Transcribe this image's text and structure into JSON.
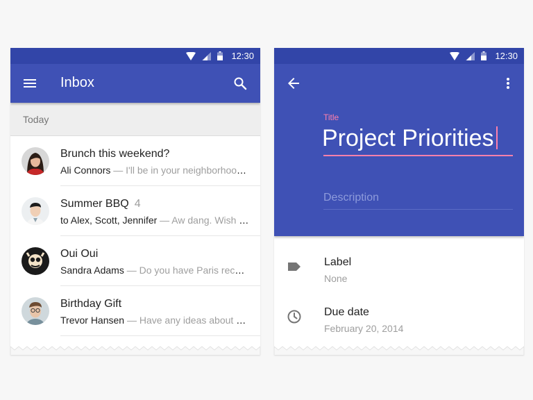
{
  "colors": {
    "primary": "#3f51b5",
    "status_bar": "#3245a8",
    "accent": "#ff80ab",
    "background": "#f7f7f7"
  },
  "status_bar": {
    "time": "12:30",
    "icons": [
      "wifi-icon",
      "signal-icon",
      "battery-icon"
    ]
  },
  "inbox": {
    "title": "Inbox",
    "nav_icon": "menu-icon",
    "action_icon": "search-icon",
    "section": "Today",
    "messages": [
      {
        "subject": "Brunch this weekend?",
        "count": "",
        "from": "Ali Connors",
        "preview": " — I'll be in your neighborhood doing errands this weekend",
        "avatar": "avatar-ali"
      },
      {
        "subject": "Summer BBQ",
        "count": "4",
        "from": "to Alex, Scott, Jennifer",
        "preview": " — Aw dang. Wish I could make it",
        "avatar": "avatar-summer"
      },
      {
        "subject": "Oui Oui",
        "count": "",
        "from": "Sandra Adams",
        "preview": " — Do you have Paris recommendations",
        "avatar": "avatar-sandra"
      },
      {
        "subject": "Birthday Gift",
        "count": "",
        "from": "Trevor Hansen",
        "preview": " — Have any ideas about what we should get",
        "avatar": "avatar-trevor"
      }
    ]
  },
  "task": {
    "back_icon": "arrow-back-icon",
    "more_icon": "more-vert-icon",
    "title_label": "Title",
    "title_value": "Project Priorities",
    "description_placeholder": "Description",
    "details": [
      {
        "icon": "label-icon",
        "title": "Label",
        "value": "None"
      },
      {
        "icon": "clock-icon",
        "title": "Due date",
        "value": "February 20, 2014"
      }
    ]
  }
}
